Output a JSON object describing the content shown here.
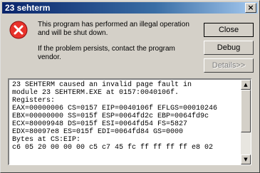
{
  "window": {
    "title": "23 sehterm",
    "close_glyph": "×"
  },
  "message": {
    "line1": "This program has performed an illegal operation",
    "line2": "and will be shut down.",
    "line3": "If the problem persists, contact the program",
    "line4": "vendor."
  },
  "buttons": {
    "close": "Close",
    "debug": "Debug",
    "details": "Details>>"
  },
  "details_text": "23 SEHTERM caused an invalid page fault in\nmodule 23 SEHTERM.EXE at 0157:0040106f.\nRegisters:\nEAX=00000006 CS=0157 EIP=0040106f EFLGS=00010246\nEBX=00000000 SS=015f ESP=0064fd2c EBP=0064fd9c\nECX=80009948 DS=015f ESI=0064fd54 FS=5827\nEDX=80097e8 ES=015f EDI=0064fd84 GS=0000\nBytes at CS:EIP:\nc6 05 20 00 00 00 c5 c7 45 fc ff ff ff ff e8 02",
  "colors": {
    "face": "#d4d0c8",
    "title_start": "#0a246a",
    "title_end": "#a6caf0",
    "error_red": "#e8322b"
  },
  "icons": {
    "error": "error-x-icon",
    "scroll_up": "scroll-up-arrow-icon",
    "scroll_down": "scroll-down-arrow-icon"
  }
}
